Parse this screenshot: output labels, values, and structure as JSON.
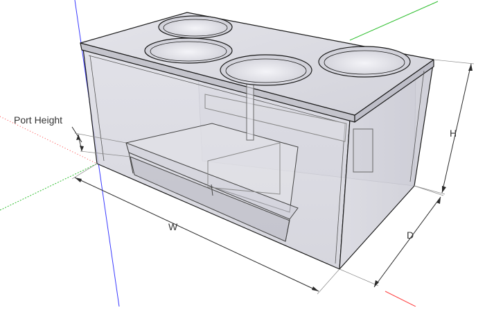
{
  "dimensions": {
    "port_height_label": "Port Height",
    "width_label": "W",
    "height_label": "H",
    "depth_label": "D"
  },
  "colors": {
    "background": "#ffffff",
    "box_fill": "#d8d8e0",
    "box_stroke": "#1a1a1a",
    "axis_red": "#ff4040",
    "axis_green": "#2fbf2f",
    "axis_blue": "#3a3aff",
    "dimension_line": "#2a2a2a"
  },
  "model": {
    "subwoofer_openings": 4,
    "view": "3d-perspective"
  }
}
